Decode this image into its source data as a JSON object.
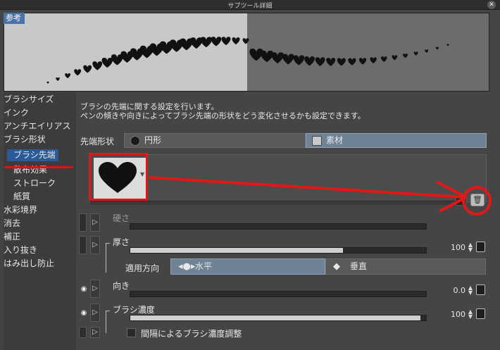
{
  "window": {
    "title": "サブツール詳細"
  },
  "preview": {
    "label": "参考"
  },
  "categories": [
    {
      "label": "ブラシサイズ"
    },
    {
      "label": "インク"
    },
    {
      "label": "アンチエイリアス"
    },
    {
      "label": "ブラシ形状"
    },
    {
      "label": "ブラシ先端"
    },
    {
      "label": "散布効果"
    },
    {
      "label": "ストローク"
    },
    {
      "label": "紙質"
    },
    {
      "label": "水彩境界"
    },
    {
      "label": "消去"
    },
    {
      "label": "補正"
    },
    {
      "label": "入り抜き"
    },
    {
      "label": "はみ出し防止"
    }
  ],
  "selected_category": "ブラシ先端",
  "description": {
    "line1": "ブラシの先端に関する設定を行います。",
    "line2": "ペンの傾きや向きによってブラシ先端の形状をどう変化させるかも設定できます。"
  },
  "tip_shape": {
    "label": "先端形状",
    "circle_label": "円形",
    "material_label": "素材",
    "selected": "素材"
  },
  "params": {
    "hardness": {
      "label": "硬さ"
    },
    "thickness": {
      "label": "厚さ",
      "value": "100",
      "fill": 0.72
    },
    "direction_apply": {
      "label": "適用方向",
      "horizontal": "水平",
      "vertical": "垂直",
      "selected": "水平"
    },
    "orientation": {
      "label": "向き",
      "value": "0.0"
    },
    "brush_density": {
      "label": "ブラシ濃度",
      "value": "100",
      "fill": 0.98
    },
    "density_adjust": {
      "label": "間隔によるブラシ濃度調整"
    }
  },
  "colors": {
    "accent": "#2c5a96",
    "annotation": "#e21818"
  }
}
